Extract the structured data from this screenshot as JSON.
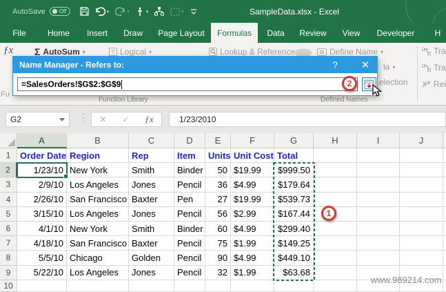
{
  "titlebar": {
    "autosave_label": "AutoSave",
    "autosave_state": "Off",
    "title": "SampleData.xlsx - Excel"
  },
  "tabs": [
    {
      "label": "File",
      "selected": false
    },
    {
      "label": "Home",
      "selected": false
    },
    {
      "label": "Insert",
      "selected": false
    },
    {
      "label": "Draw",
      "selected": false
    },
    {
      "label": "Page Layout",
      "selected": false
    },
    {
      "label": "Formulas",
      "selected": true
    },
    {
      "label": "Data",
      "selected": false
    },
    {
      "label": "Review",
      "selected": false
    },
    {
      "label": "View",
      "selected": false
    },
    {
      "label": "Developer",
      "selected": false
    },
    {
      "label": "H",
      "selected": false
    }
  ],
  "ribbon": {
    "insert_function_cut": "Fu",
    "autosum": "AutoSum",
    "logical": "Logical",
    "lookup": "Lookup & Reference",
    "define_name": "Define Name",
    "use_in_formula_cut": "la",
    "create_from_selection_cut": "election",
    "trace_precedents_cut": "Tra",
    "trace_dependents_cut": "Tra",
    "remove_arrows_cut": "Rem",
    "group_function_library": "Function Library",
    "group_defined_names": "Defined Names"
  },
  "dialog": {
    "title": "Name Manager - Refers to:",
    "help_label": "?",
    "close_label": "✕",
    "refers_to_value": "=SalesOrders!$G$2:$G$9"
  },
  "annotations": {
    "step1": "1",
    "step2": "2"
  },
  "formula_bar": {
    "name_box_value": "G2",
    "formula_value": "1/23/2010"
  },
  "watermark": "www.989214.com",
  "sheet": {
    "column_letters": [
      "A",
      "B",
      "C",
      "D",
      "E",
      "F",
      "G",
      "H",
      "I",
      "J"
    ],
    "selected_column": "A",
    "selected_row": "2",
    "selected_cell": "A2",
    "highlighted_range": "G2:G9",
    "header_row": [
      "Order Date",
      "Region",
      "Rep",
      "Item",
      "Units",
      "Unit Cost",
      "Total"
    ],
    "alignments": [
      "right",
      "left",
      "left",
      "left",
      "right",
      "left",
      "right"
    ],
    "data_rows": [
      [
        "1/23/10",
        "New York",
        "Smith",
        "Binder",
        "50",
        "$19.99",
        "$999.50"
      ],
      [
        "2/9/10",
        "Los Angeles",
        "Jones",
        "Pencil",
        "36",
        "$4.99",
        "$179.64"
      ],
      [
        "2/26/10",
        "San Francisco",
        "Baxter",
        "Pen",
        "27",
        "$19.99",
        "$539.73"
      ],
      [
        "3/15/10",
        "Los Angeles",
        "Jones",
        "Pencil",
        "56",
        "$2.99",
        "$167.44"
      ],
      [
        "4/1/10",
        "New York",
        "Smith",
        "Binder",
        "60",
        "$4.99",
        "$299.40"
      ],
      [
        "4/18/10",
        "San Francisco",
        "Baxter",
        "Pencil",
        "75",
        "$1.99",
        "$149.25"
      ],
      [
        "5/5/10",
        "Chicago",
        "Golden",
        "Pencil",
        "90",
        "$4.99",
        "$449.10"
      ],
      [
        "5/22/10",
        "Los Angeles",
        "Jones",
        "Pencil",
        "32",
        "$1.99",
        "$63.68"
      ]
    ],
    "row_count": 10
  },
  "colors": {
    "excel_green": "#217346",
    "dialog_blue": "#2b9adf",
    "header_text_blue": "#2323cf",
    "annotation_red": "#d03a34"
  }
}
